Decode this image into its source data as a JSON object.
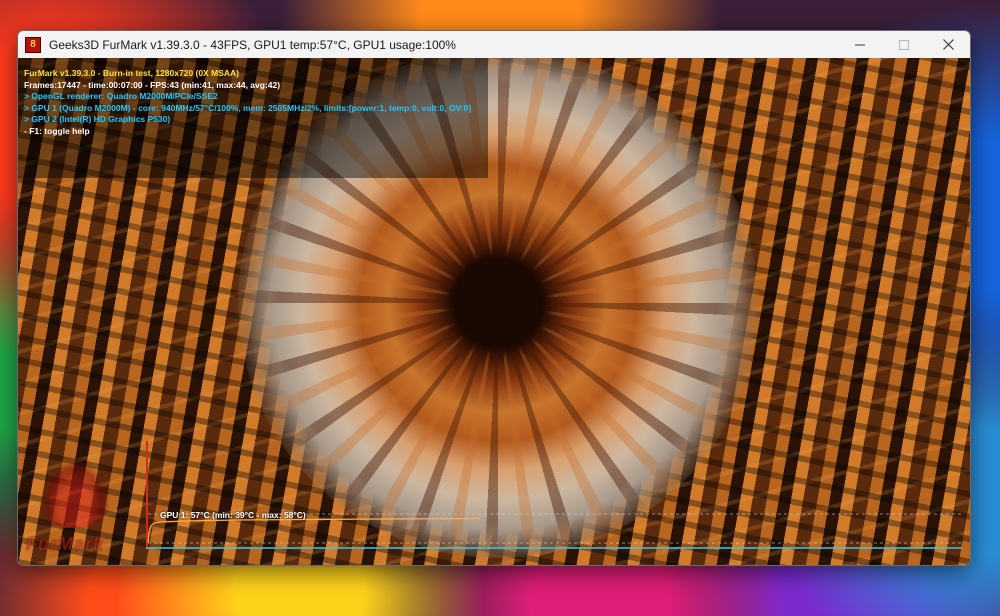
{
  "window": {
    "title": "Geeks3D FurMark v1.39.3.0 - 43FPS, GPU1 temp:57°C, GPU1 usage:100%",
    "app_icon": "furmark-app-icon",
    "controls": [
      "minimize-icon",
      "maximize-icon",
      "close-icon"
    ]
  },
  "hud": {
    "line1": "FurMark v1.39.3.0 - Burn-in test, 1280x720 (0X MSAA)",
    "line2": "Frames:17447 - time:00:07:00 - FPS:43 (min:41, max:44, avg:42)",
    "line3": "> OpenGL renderer: Quadro M2000M/PCIe/SSE2",
    "line4": "> GPU 1 (Quadro M2000M) - core: 940MHz/57°C/100%, mem: 2505MHz/2%, limits:[power:1, temp:0, volt:0, OV:0]",
    "line5": "> GPU 2 (Intel(R) HD Graphics P530)",
    "line6": "- F1: toggle help"
  },
  "logo": {
    "text": "FurMark"
  },
  "temp_graph": {
    "label": "GPU 1: 57°C (min: 39°C - max: 58°C)",
    "current_c": 57,
    "min_c": 39,
    "max_c": 58,
    "line_color": "#ffb24a",
    "baseline_color": "#3fc6e0"
  },
  "colors": {
    "hud_title": "#ffe33a",
    "hud_info": "#1ec8ff",
    "hud_text": "#ffffff"
  }
}
